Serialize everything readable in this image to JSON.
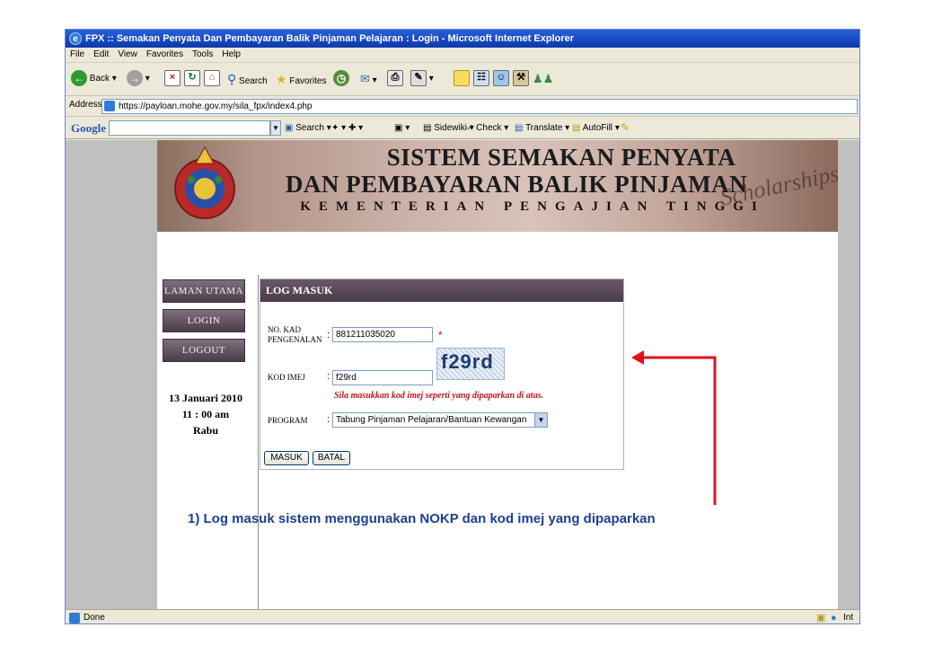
{
  "window": {
    "title": "FPX :: Semakan Penyata Dan Pembayaran Balik Pinjaman Pelajaran : Login - Microsoft Internet Explorer"
  },
  "menu": [
    "File",
    "Edit",
    "View",
    "Favorites",
    "Tools",
    "Help"
  ],
  "toolbar": {
    "back": "Back",
    "search": "Search",
    "favorites": "Favorites"
  },
  "address": {
    "label": "Address",
    "url": "https://payloan.mohe.gov.my/sila_fpx/index4.php"
  },
  "google_bar": {
    "logo": "Google",
    "search": "Search",
    "sidewiki": "Sidewiki",
    "check": "Check",
    "translate": "Translate",
    "autofill": "AutoFill"
  },
  "banner": {
    "line1": "SISTEM SEMAKAN PENYATA",
    "line2": "DAN PEMBAYARAN BALIK PINJAMAN",
    "line3": "KEMENTERIAN PENGAJIAN TINGGI",
    "script": "Scholarships"
  },
  "nav": {
    "home": "LAMAN UTAMA",
    "login": "LOGIN",
    "logout": "LOGOUT"
  },
  "datetime": {
    "date": "13 Januari 2010",
    "time": "11 : 00 am",
    "day": "Rabu"
  },
  "form": {
    "title": "LOG MASUK",
    "nokp_label_1": "NO. KAD",
    "nokp_label_2": "PENGENALAN",
    "colon": ":",
    "nokp_value": "881211035020",
    "required_mark": "*",
    "captcha_text": "f29rd",
    "kod_label": "KOD IMEJ",
    "kod_value": "f29rd",
    "instruction": "Sila masukkan kod imej seperti yang dipaparkan di atas.",
    "program_label": "PROGRAM",
    "program_value": "Tabung Pinjaman Pelajaran/Bantuan Kewangan",
    "submit": "MASUK",
    "cancel": "BATAL"
  },
  "status": {
    "text": "Done",
    "zone": "Int"
  },
  "annotation": {
    "caption": "1) Log masuk sistem menggunakan NOKP dan kod imej yang dipaparkan",
    "arrow_color": "#e0101c"
  },
  "colors": {
    "nav_button": "#5c4e5b",
    "form_header": "#5a4a59",
    "banner": "#c4a79c",
    "instruction_text": "#c0141c",
    "caption": "#1f3f8f"
  }
}
